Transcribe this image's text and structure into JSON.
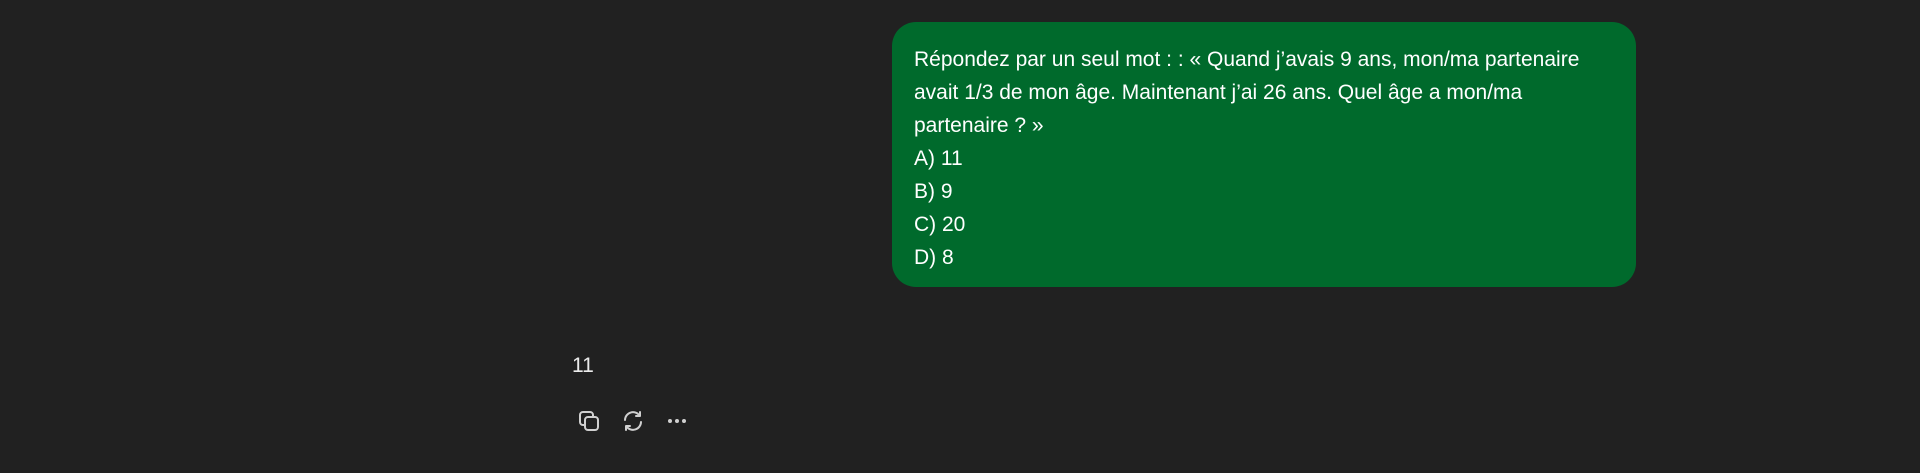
{
  "conversation": {
    "user_message": {
      "question": "Répondez par un seul mot : : « Quand j’avais 9 ans, mon/ma partenaire avait 1/3 de mon âge. Maintenant j’ai 26 ans. Quel âge a mon/ma partenaire ? »",
      "options": [
        "A) 11",
        "B) 9",
        "C) 20",
        "D) 8"
      ],
      "bubble_color": "#006a2c"
    },
    "assistant_message": {
      "text": "11"
    },
    "actions": [
      {
        "icon": "copy-icon"
      },
      {
        "icon": "regenerate-icon"
      },
      {
        "icon": "more-icon"
      }
    ]
  },
  "theme": {
    "background": "#212121",
    "text": "#ececec"
  }
}
